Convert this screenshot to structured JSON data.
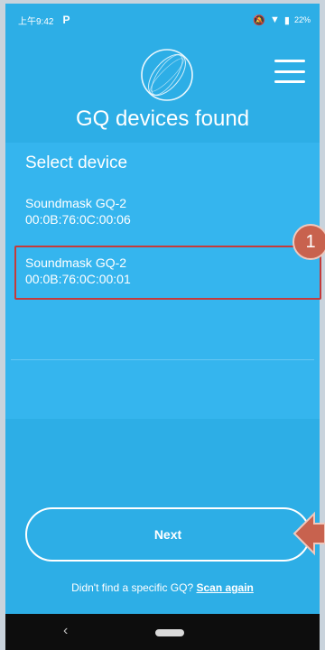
{
  "status_bar": {
    "time": "上午9:42",
    "left_icon": "P",
    "right_icons": [
      "mute-icon",
      "wifi-icon",
      "battery-icon"
    ],
    "battery": "22%"
  },
  "header": {
    "logo": "gq-ring-logo",
    "menu_icon": "hamburger-menu-icon",
    "title": "GQ devices found"
  },
  "device_list": {
    "label": "Select device",
    "devices": [
      {
        "name": "Soundmask GQ-2",
        "address": "00:0B:76:0C:00:06"
      },
      {
        "name": "Soundmask GQ-2",
        "address": "00:0B:76:0C:00:01",
        "highlighted": true
      }
    ]
  },
  "annotation": {
    "badge": "1",
    "arrow_color": "#c8624e",
    "box_color": "#c53a3a"
  },
  "actions": {
    "next_label": "Next"
  },
  "footer": {
    "prompt": "Didn't find a specific GQ?",
    "link": "Scan again"
  },
  "colors": {
    "background": "#2daee6",
    "panel": "#35b5ee",
    "nav_bar": "#0d0d0d"
  }
}
